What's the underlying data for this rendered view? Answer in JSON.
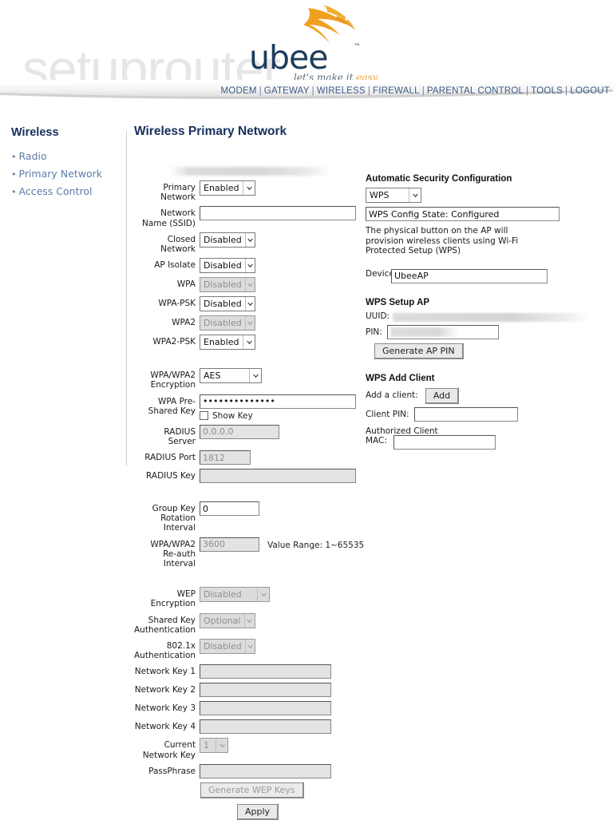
{
  "brand": {
    "logo_word": "ubee",
    "logo_tm": "™",
    "tagline_1": "let's make it ",
    "tagline_2": "easy",
    "watermark": "setuprouter",
    "logo_color": "#f0a020",
    "wordmark_color": "#1d3c5c"
  },
  "nav": {
    "items": [
      "MODEM",
      "GATEWAY",
      "WIRELESS",
      "FIREWALL",
      "PARENTAL CONTROL",
      "TOOLS",
      "LOGOUT"
    ],
    "separator": "|",
    "link_color": "#3b5a86"
  },
  "sidebar": {
    "title": "Wireless",
    "items": [
      {
        "label": "Radio"
      },
      {
        "label": "Primary Network"
      },
      {
        "label": "Access Control"
      }
    ]
  },
  "page": {
    "title": "Wireless Primary Network",
    "title_color": "#16305c"
  },
  "form": {
    "primary_network": {
      "label": "Primary Network",
      "value": "Enabled",
      "disabled": false
    },
    "ssid": {
      "label": "Network Name (SSID)",
      "value": "",
      "redacted": true
    },
    "closed_network": {
      "label": "Closed Network",
      "value": "Disabled",
      "disabled": false
    },
    "ap_isolate": {
      "label": "AP Isolate",
      "value": "Disabled",
      "disabled": false
    },
    "wpa": {
      "label": "WPA",
      "value": "Disabled",
      "disabled": true
    },
    "wpa_psk": {
      "label": "WPA-PSK",
      "value": "Disabled",
      "disabled": false
    },
    "wpa2": {
      "label": "WPA2",
      "value": "Disabled",
      "disabled": true
    },
    "wpa2_psk": {
      "label": "WPA2-PSK",
      "value": "Enabled",
      "disabled": false
    },
    "encryption": {
      "label": "WPA/WPA2 Encryption",
      "value": "AES",
      "disabled": false
    },
    "psk": {
      "label": "WPA Pre-Shared Key",
      "value": "••••••••••••••"
    },
    "show_key": {
      "label": "Show Key",
      "checked": false
    },
    "radius_server": {
      "label": "RADIUS Server",
      "value": "0.0.0.0",
      "disabled": true
    },
    "radius_port": {
      "label": "RADIUS Port",
      "value": "1812",
      "disabled": true
    },
    "radius_key": {
      "label": "RADIUS Key",
      "value": "",
      "disabled": true
    },
    "group_key_rot": {
      "label": "Group Key Rotation Interval",
      "value": "0",
      "disabled": false
    },
    "reauth": {
      "label": "WPA/WPA2 Re-auth Interval",
      "value": "3600",
      "disabled": true,
      "hint": "Value Range: 1~65535"
    },
    "wep_encryption": {
      "label": "WEP Encryption",
      "value": "Disabled",
      "disabled": true
    },
    "shared_key_auth": {
      "label": "Shared Key Authentication",
      "value": "Optional",
      "disabled": true
    },
    "dot1x_auth": {
      "label": "802.1x Authentication",
      "value": "Disabled",
      "disabled": true
    },
    "net_key_1": {
      "label": "Network Key 1",
      "value": "",
      "disabled": true
    },
    "net_key_2": {
      "label": "Network Key 2",
      "value": "",
      "disabled": true
    },
    "net_key_3": {
      "label": "Network Key 3",
      "value": "",
      "disabled": true
    },
    "net_key_4": {
      "label": "Network Key 4",
      "value": "",
      "disabled": true
    },
    "current_net_key": {
      "label": "Current Network Key",
      "value": "1",
      "disabled": true
    },
    "passphrase": {
      "label": "PassPhrase",
      "value": "",
      "disabled": true
    },
    "generate_wep": {
      "label": "Generate WEP Keys"
    },
    "apply": {
      "label": "Apply"
    }
  },
  "auto_security": {
    "heading": "Automatic Security Configuration",
    "mode": "WPS",
    "config_state": "WPS Config State: Configured",
    "description": "The physical button on the AP will provision wireless clients using Wi-Fi Protected Setup (WPS)",
    "device_name_label": "Device Name",
    "device_name": "UbeeAP"
  },
  "wps_setup_ap": {
    "heading": "WPS Setup AP",
    "uuid_label": "UUID:",
    "uuid_value": "",
    "pin_label": "PIN:",
    "pin_value": "",
    "generate_pin": "Generate AP PIN"
  },
  "wps_add_client": {
    "heading": "WPS Add Client",
    "add_client_label": "Add a client:",
    "add_button": "Add",
    "client_pin_label": "Client PIN:",
    "client_pin_value": "",
    "authorized_mac_label": "Authorized Client MAC:",
    "authorized_mac_value": ""
  }
}
